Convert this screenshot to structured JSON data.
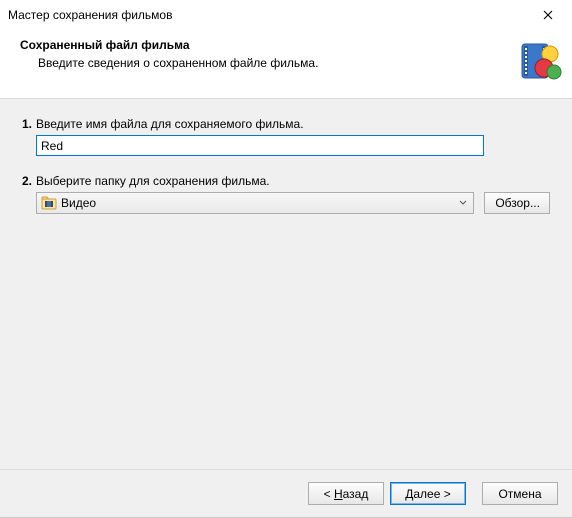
{
  "window": {
    "title": "Мастер сохранения фильмов"
  },
  "header": {
    "title": "Сохраненный файл фильма",
    "subtitle": "Введите сведения о сохраненном файле фильма."
  },
  "step1": {
    "number": "1.",
    "label": "Введите имя файла для сохраняемого фильма.",
    "value": "Red"
  },
  "step2": {
    "number": "2.",
    "label": "Выберите папку для сохранения фильма.",
    "selected": "Видео",
    "browse": "Обзор..."
  },
  "footer": {
    "back_prefix": "< ",
    "back_u": "Н",
    "back_rest": "азад",
    "next_u": "Д",
    "next_rest": "алее >",
    "cancel": "Отмена"
  },
  "icons": {
    "close": "close-icon",
    "app": "movie-maker-icon",
    "folder": "video-folder-icon",
    "chevron": "chevron-down-icon"
  }
}
